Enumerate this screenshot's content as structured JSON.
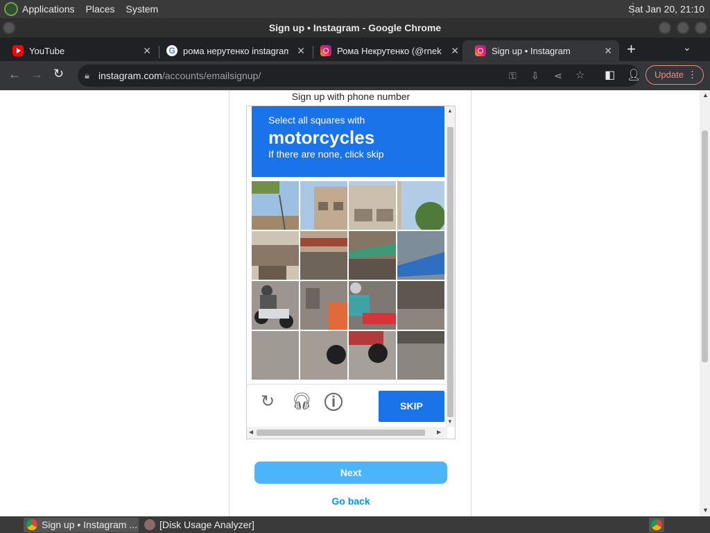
{
  "desktop": {
    "menus": [
      "Applications",
      "Places",
      "System"
    ],
    "clock": "Sat Jan 20, 21:10"
  },
  "window": {
    "title": "Sign up • Instagram - Google Chrome"
  },
  "tabs": [
    {
      "label": "YouTube",
      "icon": "youtube-icon"
    },
    {
      "label": "рома нерутенко instagram",
      "icon": "google-icon"
    },
    {
      "label": "Рома Некрутенко (@rnek",
      "icon": "instagram-icon"
    },
    {
      "label": "Sign up • Instagram",
      "icon": "instagram-icon",
      "active": true
    }
  ],
  "toolbar": {
    "url_host": "instagram.com",
    "url_path": "/accounts/emailsignup/",
    "update_label": "Update"
  },
  "page": {
    "phone_link": "Sign up with phone number",
    "next_label": "Next",
    "go_back_label": "Go back"
  },
  "captcha": {
    "line1": "Select all squares with",
    "target": "motorcycles",
    "line3": "If there are none, click skip",
    "skip_label": "SKIP",
    "accent": "#1a73e8"
  },
  "taskbar": {
    "items": [
      "Sign up • Instagram ...",
      "[Disk Usage Analyzer]"
    ]
  }
}
